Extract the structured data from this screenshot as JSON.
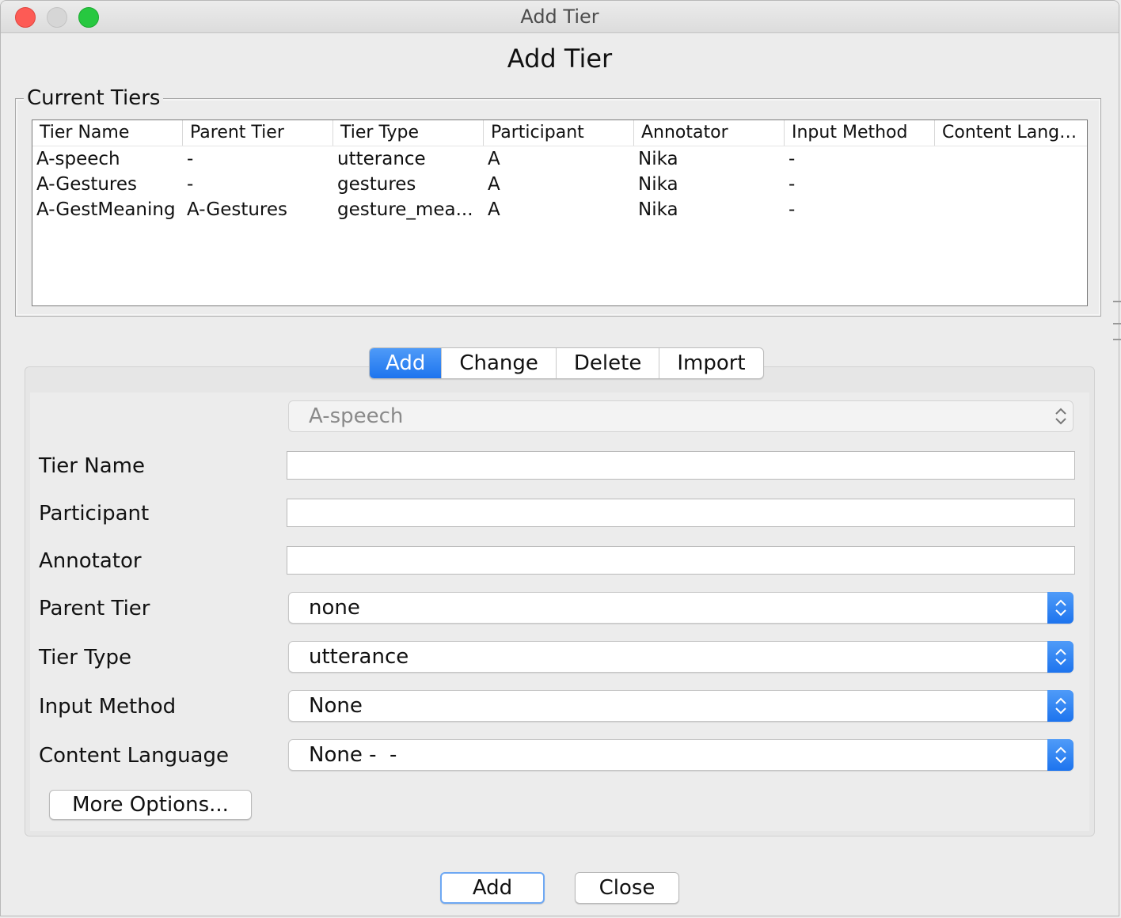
{
  "window": {
    "title": "Add Tier"
  },
  "heading": "Add Tier",
  "current_tiers": {
    "title": "Current Tiers",
    "columns": [
      "Tier Name",
      "Parent Tier",
      "Tier Type",
      "Participant",
      "Annotator",
      "Input Method",
      "Content Langu..."
    ],
    "rows": [
      [
        "A-speech",
        "-",
        "utterance",
        "A",
        "Nika",
        "-",
        ""
      ],
      [
        "A-Gestures",
        "-",
        "gestures",
        "A",
        "Nika",
        "-",
        ""
      ],
      [
        "A-GestMeaning",
        "A-Gestures",
        "gesture_mea...",
        "A",
        "Nika",
        "-",
        ""
      ]
    ]
  },
  "tabs": [
    {
      "label": "Add",
      "active": true
    },
    {
      "label": "Change",
      "active": false
    },
    {
      "label": "Delete",
      "active": false
    },
    {
      "label": "Import",
      "active": false
    }
  ],
  "form": {
    "tier_selector": {
      "value": "A-speech"
    },
    "tier_name": {
      "label": "Tier Name",
      "value": ""
    },
    "participant": {
      "label": "Participant",
      "value": ""
    },
    "annotator": {
      "label": "Annotator",
      "value": ""
    },
    "parent_tier": {
      "label": "Parent Tier",
      "value": "none"
    },
    "tier_type": {
      "label": "Tier Type",
      "value": "utterance"
    },
    "input_method": {
      "label": "Input Method",
      "value": "None"
    },
    "content_language": {
      "label": "Content Language",
      "value": "None -  -"
    },
    "more_options_label": "More Options..."
  },
  "buttons": {
    "add_label": "Add",
    "close_label": "Close"
  },
  "colors": {
    "accent": "#1d74ee",
    "window_bg": "#ececec"
  }
}
